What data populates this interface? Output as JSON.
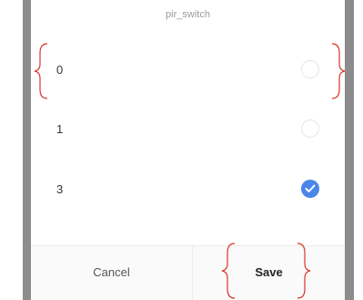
{
  "dialog": {
    "title": "pir_switch"
  },
  "options": [
    {
      "label": "0",
      "selected": false
    },
    {
      "label": "1",
      "selected": false
    },
    {
      "label": "3",
      "selected": true
    }
  ],
  "footer": {
    "cancel_label": "Cancel",
    "save_label": "Save"
  },
  "colors": {
    "accent": "#4a86e8",
    "annotation": "#d9342b",
    "side_bar": "#8c8c8c"
  }
}
